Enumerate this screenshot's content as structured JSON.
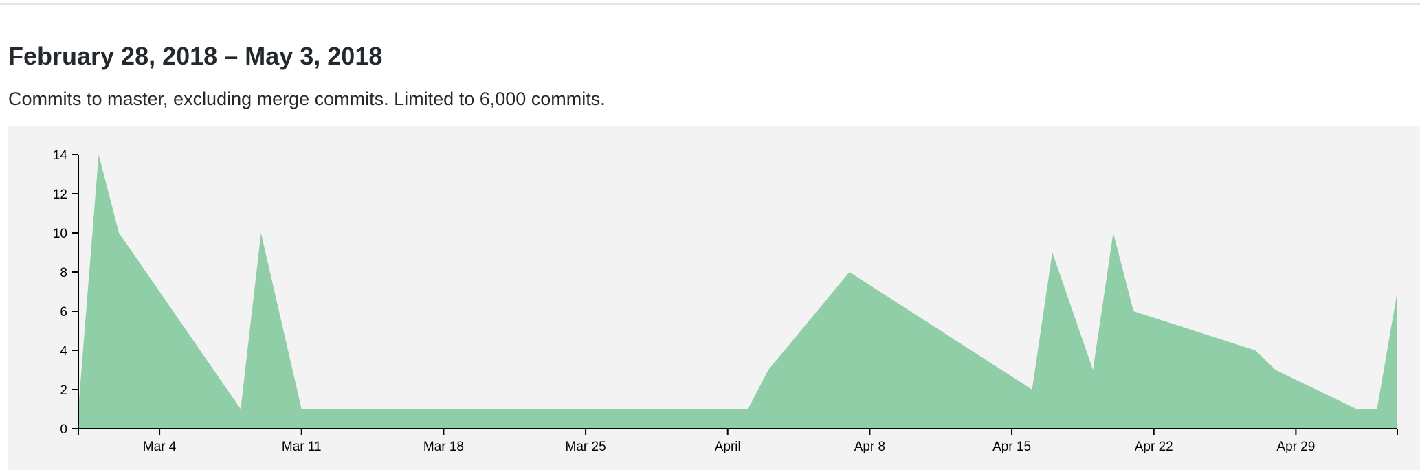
{
  "header": {
    "date_range": "February 28, 2018 – May 3, 2018",
    "description": "Commits to master, excluding merge commits. Limited to 6,000 commits."
  },
  "colors": {
    "area_fill": "#8fcea7",
    "panel_background": "#f3f3f3",
    "axis": "#000000"
  },
  "chart_data": {
    "type": "area",
    "title": "",
    "xlabel": "",
    "ylabel": "",
    "grid": false,
    "legend": "none",
    "x": [
      "2018-02-28",
      "2018-03-01",
      "2018-03-02",
      "2018-03-08",
      "2018-03-09",
      "2018-03-11",
      "2018-04-02",
      "2018-04-03",
      "2018-04-07",
      "2018-04-16",
      "2018-04-17",
      "2018-04-19",
      "2018-04-20",
      "2018-04-21",
      "2018-04-27",
      "2018-04-28",
      "2018-05-02",
      "2018-05-03",
      "2018-05-04"
    ],
    "values": [
      1,
      14,
      10,
      1,
      10,
      1,
      1,
      3,
      8,
      2,
      9,
      3,
      10,
      6,
      4,
      3,
      1,
      1,
      7
    ],
    "xlim": [
      "2018-02-28",
      "2018-05-04"
    ],
    "ylim": [
      0,
      14
    ],
    "x_ticks": [
      {
        "date": "2018-03-04",
        "label": "Mar 4"
      },
      {
        "date": "2018-03-11",
        "label": "Mar 11"
      },
      {
        "date": "2018-03-18",
        "label": "Mar 18"
      },
      {
        "date": "2018-03-25",
        "label": "Mar 25"
      },
      {
        "date": "2018-04-01",
        "label": "April"
      },
      {
        "date": "2018-04-08",
        "label": "Apr 8"
      },
      {
        "date": "2018-04-15",
        "label": "Apr 15"
      },
      {
        "date": "2018-04-22",
        "label": "Apr 22"
      },
      {
        "date": "2018-04-29",
        "label": "Apr 29"
      }
    ],
    "y_ticks": [
      0,
      2,
      4,
      6,
      8,
      10,
      12,
      14
    ]
  }
}
